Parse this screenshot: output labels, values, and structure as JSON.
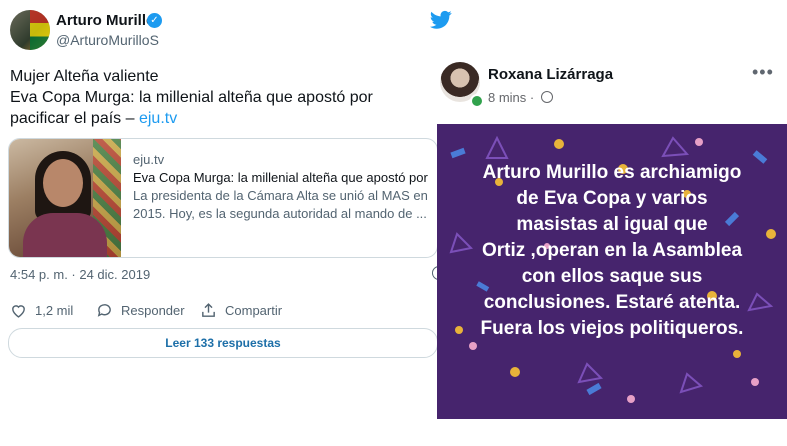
{
  "tweet": {
    "author_name": "Arturo Murillo",
    "author_handle": "@ArturoMurilloS",
    "text_line1": "Mujer Alteña valiente",
    "text_line2": "Eva Copa Murga: la millenial alteña que apostó por",
    "text_line3": "pacificar el país –",
    "text_link": "eju.tv",
    "card": {
      "domain": "eju.tv",
      "title": "Eva Copa Murga: la millenial alteña que apostó por ...",
      "desc_line1": "La presidenta de la Cámara Alta se unió al MAS en",
      "desc_line2": "2015. Hoy, es la  segunda autoridad al mando de ..."
    },
    "timestamp": "4:54 p. m. · 24 dic. 2019",
    "likes": "1,2 mil",
    "reply_label": "Responder",
    "share_label": "Compartir",
    "read_replies": "Leer 133 respuestas",
    "colors": {
      "accent": "#1d9bf0",
      "text": "#0f1419",
      "muted": "#536471"
    }
  },
  "fb_post": {
    "author_name": "Roxana Lizárraga",
    "time": "8 mins ·",
    "more": "•••",
    "message_lines": [
      "Arturo Murillo es archiamigo",
      "de Eva Copa y varios",
      "masistas al igual que",
      "Ortiz ,operan en la Asamblea",
      "con ellos saque sus",
      "conclusiones. Estaré atenta.",
      "Fuera los viejos politiqueros."
    ],
    "colors": {
      "banner": "#46246d",
      "online": "#31a24c"
    }
  }
}
